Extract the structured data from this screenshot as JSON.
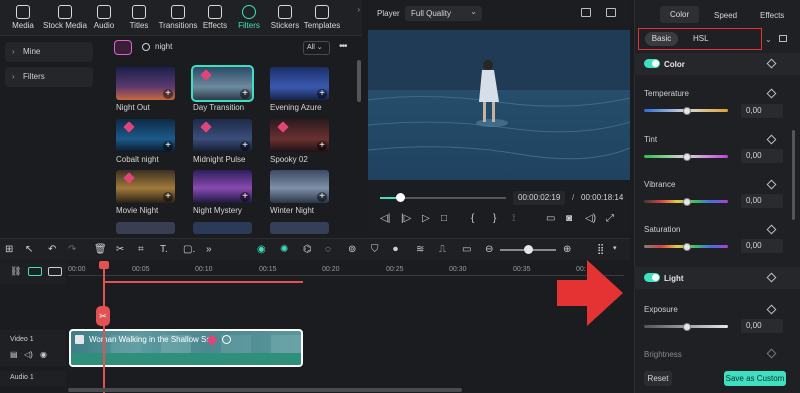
{
  "toolbar": {
    "tools": [
      {
        "label": "Media",
        "icon": "media-icon"
      },
      {
        "label": "Stock Media",
        "icon": "stock-media-icon"
      },
      {
        "label": "Audio",
        "icon": "audio-icon"
      },
      {
        "label": "Titles",
        "icon": "titles-icon"
      },
      {
        "label": "Transitions",
        "icon": "transitions-icon"
      },
      {
        "label": "Effects",
        "icon": "effects-icon"
      },
      {
        "label": "Filters",
        "icon": "filters-icon",
        "active": true
      },
      {
        "label": "Stickers",
        "icon": "stickers-icon"
      },
      {
        "label": "Templates",
        "icon": "templates-icon"
      }
    ]
  },
  "sidebar": {
    "items": [
      {
        "label": "Mine"
      },
      {
        "label": "Filters"
      }
    ]
  },
  "filters": {
    "search_value": "night",
    "all_label": "All",
    "items": [
      {
        "label": "Night Out",
        "premium": false
      },
      {
        "label": "Day Transition",
        "premium": true,
        "selected": true
      },
      {
        "label": "Evening Azure",
        "premium": false
      },
      {
        "label": "Cobalt night",
        "premium": true
      },
      {
        "label": "Midnight Pulse",
        "premium": true
      },
      {
        "label": "Spooky 02",
        "premium": true
      },
      {
        "label": "Movie Night",
        "premium": true
      },
      {
        "label": "Night Mystery",
        "premium": false
      },
      {
        "label": "Winter Night",
        "premium": false
      }
    ]
  },
  "player": {
    "label": "Player",
    "quality": "Full Quality",
    "current_time": "00:00:02:19",
    "total_time": "00:00:18:14",
    "progress": 0.13
  },
  "properties": {
    "tabs": [
      "Color",
      "Speed",
      "Effects"
    ],
    "active_tab": "Color",
    "subtabs": [
      "Basic",
      "HSL"
    ],
    "sections": {
      "color_title": "Color",
      "light_title": "Light"
    },
    "params": [
      {
        "label": "Temperature",
        "value": "0,00"
      },
      {
        "label": "Tint",
        "value": "0,00"
      },
      {
        "label": "Vibrance",
        "value": "0,00"
      },
      {
        "label": "Saturation",
        "value": "0,00"
      },
      {
        "label": "Exposure",
        "value": "0,00"
      },
      {
        "label": "Brightness",
        "value": ""
      }
    ],
    "reset_label": "Reset",
    "save_label": "Save as Custom"
  },
  "timeline": {
    "ruler": [
      "00:00",
      "00:05",
      "00:10",
      "00:15",
      "00:20",
      "00:25",
      "00:30",
      "00:35",
      "00:"
    ],
    "clip_title": "Woman Walking in the Shallow Sea",
    "video_track_label": "Video 1",
    "audio_track_label": "Audio 1"
  },
  "colors": {
    "accent": "#3ee0c0",
    "playhead": "#e25252",
    "highlight_box": "#e53333",
    "premium_gem": "#e0457a"
  }
}
